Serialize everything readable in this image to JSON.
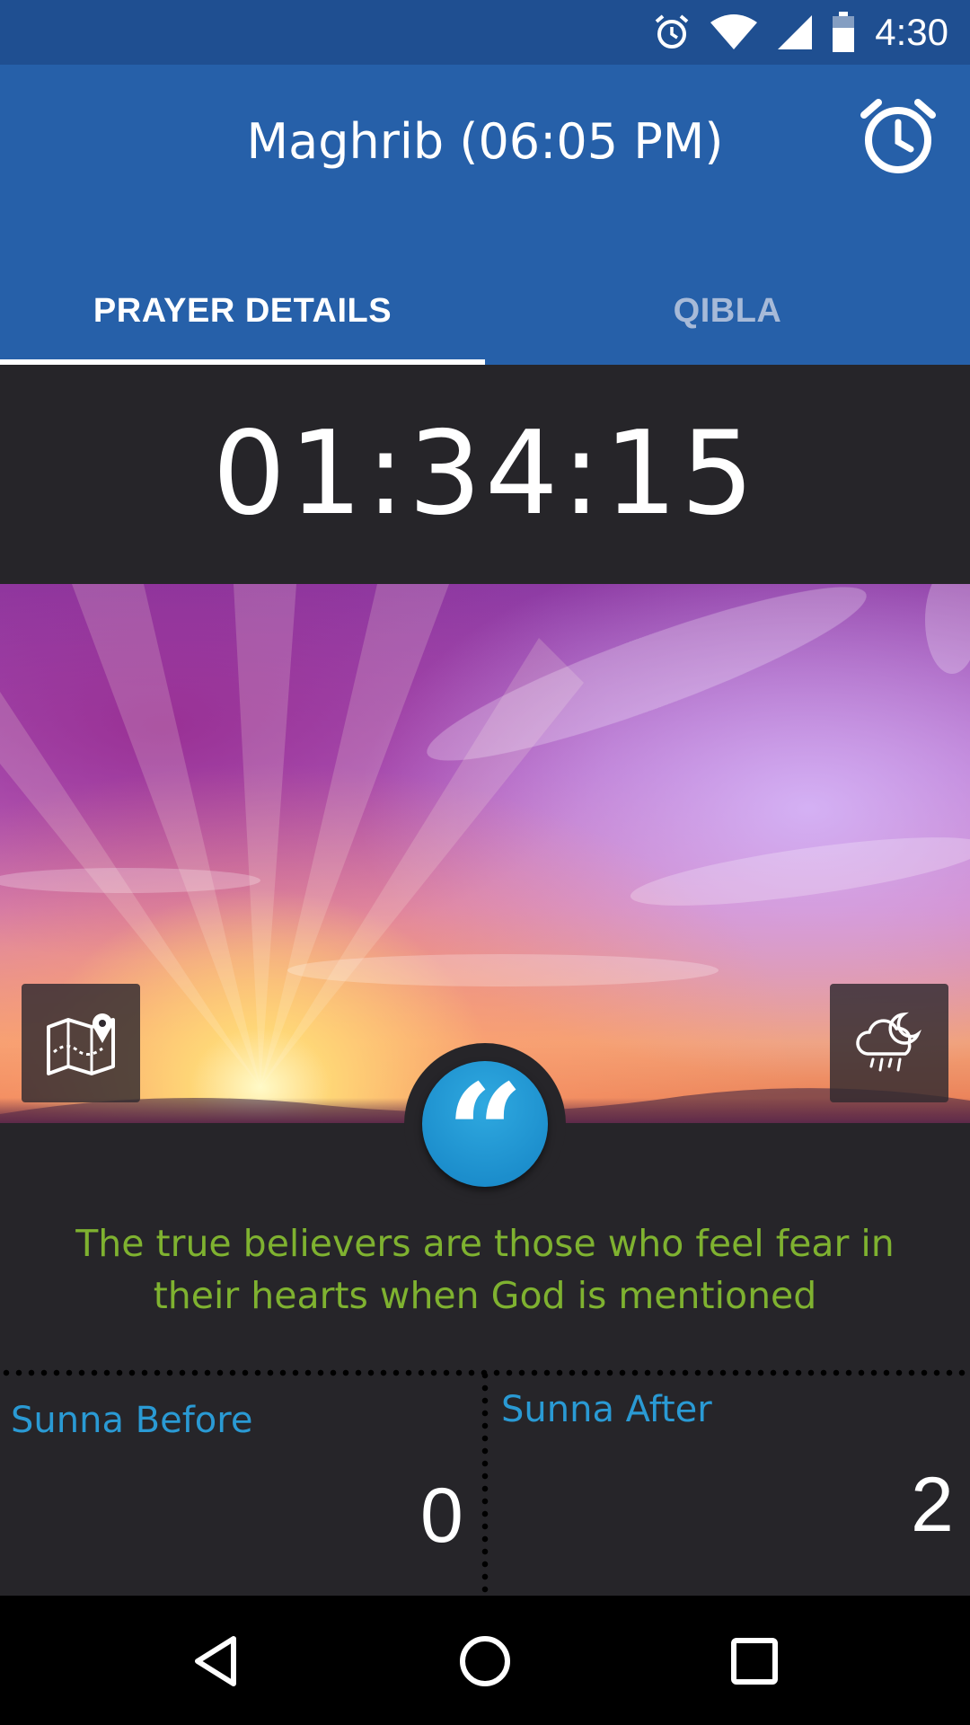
{
  "status_bar": {
    "time": "4:30",
    "icons": [
      "alarm-icon",
      "wifi-icon",
      "signal-icon",
      "battery-icon"
    ]
  },
  "app_bar": {
    "title": "Maghrib (06:05 PM)",
    "action_icon": "alarm-clock-icon",
    "tabs": [
      {
        "label": "PRAYER DETAILS",
        "selected": true
      },
      {
        "label": "QIBLA",
        "selected": false
      }
    ]
  },
  "countdown": "01:34:15",
  "hero": {
    "left_button_icon": "map-pin-icon",
    "right_button_icon": "weather-rain-moon-icon",
    "center_button_icon": "quote-icon",
    "quote_glyph": "“"
  },
  "quote": {
    "text": "The true believers are those who feel fear in their hearts when God is mentioned"
  },
  "sunna": {
    "before_label": "Sunna Before",
    "before_value": "0",
    "after_label": "Sunna After",
    "after_value": "2"
  },
  "colors": {
    "status_bar": "#1f4f91",
    "app_bar": "#2660a9",
    "background": "#262529",
    "quote_text": "#7fb230",
    "sunna_label": "#2a9ad4",
    "quote_button": "#1a8fd0"
  },
  "nav_bar": {
    "icons": [
      "back-icon",
      "home-icon",
      "recents-icon"
    ]
  }
}
